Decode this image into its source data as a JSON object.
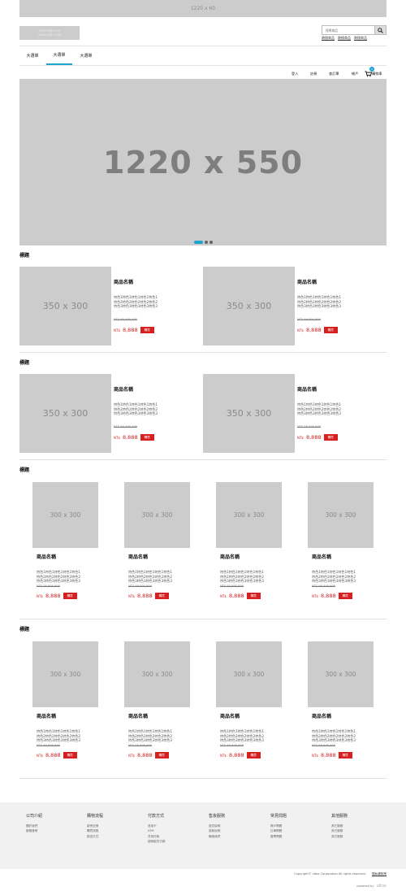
{
  "top_banner": {
    "text": "1220 x 60"
  },
  "logo": {
    "line1": "LOGO 500 x 50",
    "line2": "retina 500 x 100"
  },
  "search": {
    "placeholder": "搜尋商品",
    "hot_words": [
      "熱搜商品",
      "熱搜商品",
      "熱搜商品"
    ]
  },
  "main_nav": {
    "tabs": [
      "大選單",
      "大選單",
      "大選單"
    ],
    "active_index": 1
  },
  "member_nav": {
    "login": "登入",
    "register": "註冊",
    "orders": "查訂單",
    "account": "帳戶",
    "cart": "購物車",
    "cart_count": "0"
  },
  "hero": {
    "text": "1220 x 550",
    "slides": 3,
    "active_slide": 1
  },
  "accent_color": "#1fa3d0",
  "price_color": "#d61f1f",
  "sections": [
    {
      "title": "標題",
      "layout": "large",
      "products": [
        {
          "image": "350 x 300",
          "name": "商品名稱",
          "desc": [
            "特色1特色1特色1特色1特色1",
            "特色2特色2特色2特色2特色2",
            "特色3特色3特色3特色3特色3"
          ],
          "old_price": "NT$ 99,999,999",
          "currency": "NT$",
          "price": "8,888",
          "buy": "購買"
        },
        {
          "image": "350 x 300",
          "name": "商品名稱",
          "desc": [
            "特色1特色1特色1特色1特色1",
            "特色2特色2特色2特色2特色2",
            "特色3特色3特色3特色3特色3"
          ],
          "old_price": "NT$ 99,999,999",
          "currency": "NT$",
          "price": "8,888",
          "buy": "購買"
        }
      ]
    },
    {
      "title": "標題",
      "layout": "large",
      "products": [
        {
          "image": "350 x 300",
          "name": "商品名稱",
          "desc": [
            "特色1特色1特色1特色1特色1",
            "特色2特色2特色2特色2特色2",
            "特色3特色3特色3特色3特色3"
          ],
          "old_price": "NT$ 99,999,999",
          "currency": "NT$",
          "price": "8,888",
          "buy": "購買"
        },
        {
          "image": "350 x 300",
          "name": "商品名稱",
          "desc": [
            "特色1特色1特色1特色1特色1",
            "特色2特色2特色2特色2特色2",
            "特色3特色3特色3特色3特色3"
          ],
          "old_price": "NT$ 99,999,999",
          "currency": "NT$",
          "price": "8,888",
          "buy": "購買"
        }
      ]
    },
    {
      "title": "標題",
      "layout": "small",
      "products": [
        {
          "image": "300 x 300",
          "name": "商品名稱",
          "desc": [
            "特色1特色1特色1特色1特色1",
            "特色2特色2特色2特色2特色2",
            "特色3特色3特色3特色3特色3"
          ],
          "old_price": "NT$ 99,999,999",
          "currency": "NT$",
          "price": "8,888",
          "buy": "購買"
        },
        {
          "image": "300 x 300",
          "name": "商品名稱",
          "desc": [
            "特色1特色1特色1特色1特色1",
            "特色2特色2特色2特色2特色2",
            "特色3特色3特色3特色3特色3"
          ],
          "old_price": "NT$ 99,999,999",
          "currency": "NT$",
          "price": "8,888",
          "buy": "購買"
        },
        {
          "image": "300 x 300",
          "name": "商品名稱",
          "desc": [
            "特色1特色1特色1特色1特色1",
            "特色2特色2特色2特色2特色2",
            "特色3特色3特色3特色3特色3"
          ],
          "old_price": "NT$ 99,999,999",
          "currency": "NT$",
          "price": "8,888",
          "buy": "購買"
        },
        {
          "image": "300 x 300",
          "name": "商品名稱",
          "desc": [
            "特色1特色1特色1特色1特色1",
            "特色2特色2特色2特色2特色2",
            "特色3特色3特色3特色3特色3"
          ],
          "old_price": "NT$ 99,999,999",
          "currency": "NT$",
          "price": "8,888",
          "buy": "購買"
        }
      ]
    },
    {
      "title": "標題",
      "layout": "small",
      "products": [
        {
          "image": "300 x 300",
          "name": "商品名稱",
          "desc": [
            "特色1特色1特色1特色1特色1",
            "特色2特色2特色2特色2特色2",
            "特色3特色3特色3特色3特色3"
          ],
          "old_price": "NT$ 99,999,999",
          "currency": "NT$",
          "price": "8,888",
          "buy": "購買"
        },
        {
          "image": "300 x 300",
          "name": "商品名稱",
          "desc": [
            "特色1特色1特色1特色1特色1",
            "特色2特色2特色2特色2特色2",
            "特色3特色3特色3特色3特色3"
          ],
          "old_price": "NT$ 99,999,999",
          "currency": "NT$",
          "price": "8,888",
          "buy": "購買"
        },
        {
          "image": "300 x 300",
          "name": "商品名稱",
          "desc": [
            "特色1特色1特色1特色1特色1",
            "特色2特色2特色2特色2特色2",
            "特色3特色3特色3特色3特色3"
          ],
          "old_price": "NT$ 99,999,999",
          "currency": "NT$",
          "price": "8,888",
          "buy": "購買"
        },
        {
          "image": "300 x 300",
          "name": "商品名稱",
          "desc": [
            "特色1特色1特色1特色1特色1",
            "特色2特色2特色2特色2特色2",
            "特色3特色3特色3特色3特色3"
          ],
          "old_price": "NT$ 99,999,999",
          "currency": "NT$",
          "price": "8,888",
          "buy": "購買"
        }
      ]
    }
  ],
  "footer": {
    "columns": [
      {
        "title": "公司介紹",
        "links": [
          "關於我們",
          "服務聲明"
        ]
      },
      {
        "title": "購物流程",
        "links": [
          "新會註冊",
          "購買流程",
          "配送方式"
        ]
      },
      {
        "title": "付款方式",
        "links": [
          "信用卡",
          "ATM",
          "貨到付款",
          "超商取貨付款"
        ]
      },
      {
        "title": "售後服務",
        "links": [
          "退貨說明",
          "退款說明",
          "聯絡我們"
        ]
      },
      {
        "title": "常見問題",
        "links": [
          "帳戶問題",
          "訂單問題",
          "發票問題"
        ]
      },
      {
        "title": "其他服務",
        "links": [
          "其它服務",
          "其它服務",
          "其它服務"
        ]
      }
    ],
    "copyright": "Copyright© ultox Corporation All rights reserved.",
    "privacy": "隱私權政策",
    "powered_by": "powered by",
    "powered_brand": "ultox"
  }
}
